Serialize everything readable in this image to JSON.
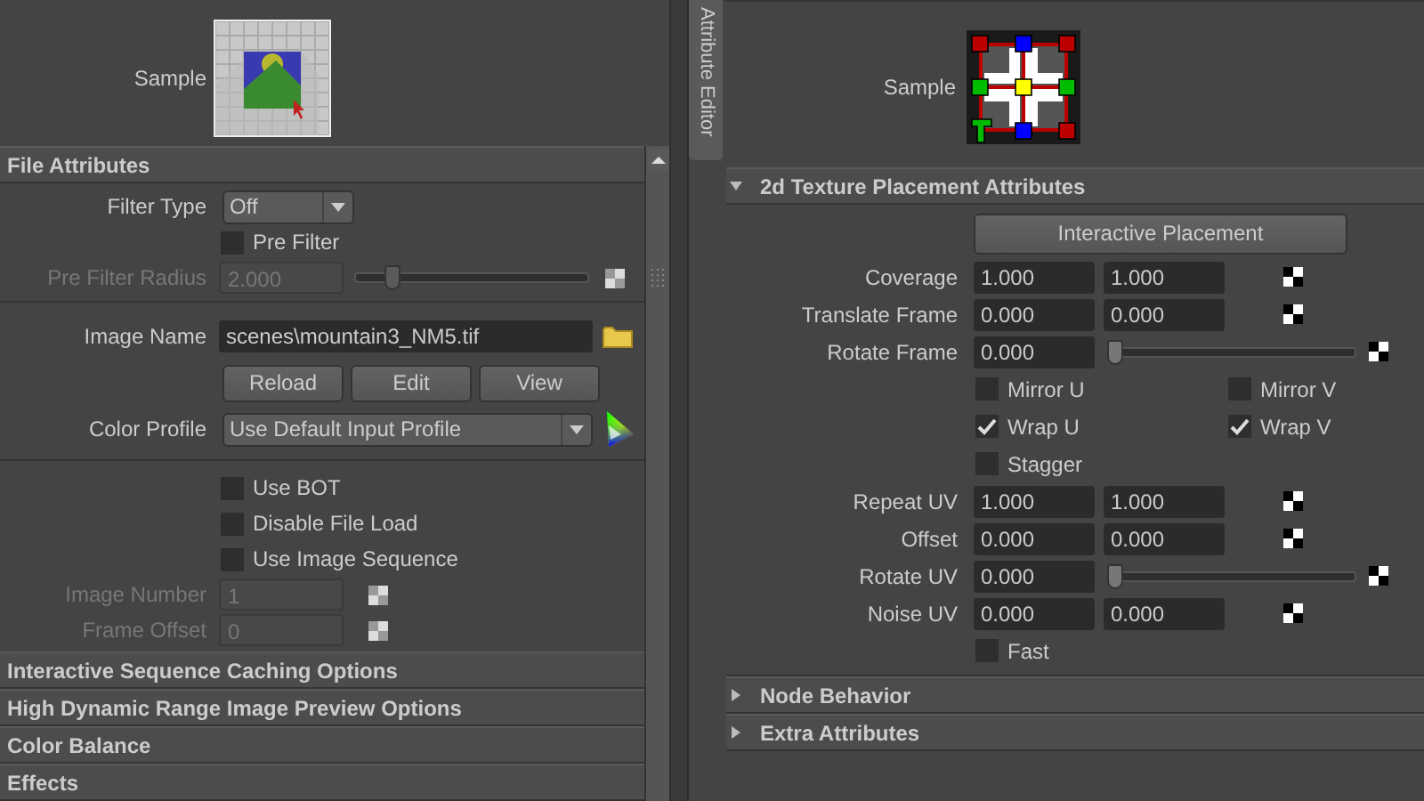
{
  "left_panel": {
    "sample_label": "Sample",
    "file_attributes": {
      "title": "File Attributes",
      "groups": [
        [
          {
            "kind": "dropdown",
            "label": "Filter Type",
            "value": "Off"
          },
          {
            "kind": "checkbox",
            "label": "Pre Filter",
            "checked": false
          },
          {
            "kind": "slider",
            "label": "Pre Filter Radius",
            "value": "2.000",
            "level": 0.13,
            "disabled": true
          }
        ],
        [
          {
            "kind": "file",
            "label": "Image Name",
            "value": "scenes\\mountain3_NM5.tif"
          },
          {
            "kind": "buttons",
            "buttons": [
              "Reload",
              "Edit",
              "View"
            ]
          },
          {
            "kind": "profile",
            "label": "Color Profile",
            "value": "Use Default Input Profile"
          }
        ],
        [
          {
            "kind": "checkbox",
            "label": "Use BOT",
            "checked": false
          },
          {
            "kind": "checkbox",
            "label": "Disable File Load",
            "checked": false
          },
          {
            "kind": "checkbox",
            "label": "Use Image Sequence",
            "checked": false
          },
          {
            "kind": "number",
            "label": "Image Number",
            "value": "1",
            "disabled": true
          },
          {
            "kind": "number",
            "label": "Frame Offset",
            "value": "0",
            "disabled": true
          }
        ]
      ]
    },
    "collapsed_sections": [
      "Interactive Sequence Caching Options",
      "High Dynamic Range Image Preview Options",
      "Color Balance",
      "Effects"
    ]
  },
  "side_tab": {
    "label": "Attribute Editor"
  },
  "right_panel": {
    "sample_label": "Sample",
    "sections": [
      {
        "title": "2d Texture Placement Attributes",
        "expanded": true,
        "rows": [
          {
            "kind": "button",
            "label": "Interactive Placement"
          },
          {
            "kind": "pair",
            "label": "Coverage",
            "values": [
              "1.000",
              "1.000"
            ]
          },
          {
            "kind": "pair",
            "label": "Translate Frame",
            "values": [
              "0.000",
              "0.000"
            ]
          },
          {
            "kind": "slider",
            "label": "Rotate Frame",
            "value": "0.000",
            "level": 0
          },
          {
            "kind": "checkpair",
            "items": [
              {
                "label": "Mirror U",
                "checked": false
              },
              {
                "label": "Mirror V",
                "checked": false
              }
            ]
          },
          {
            "kind": "checkpair",
            "items": [
              {
                "label": "Wrap U",
                "checked": true
              },
              {
                "label": "Wrap V",
                "checked": true
              }
            ]
          },
          {
            "kind": "checkbox",
            "label": "Stagger",
            "checked": false
          },
          {
            "kind": "pair",
            "label": "Repeat UV",
            "values": [
              "1.000",
              "1.000"
            ]
          },
          {
            "kind": "pair",
            "label": "Offset",
            "values": [
              "0.000",
              "0.000"
            ]
          },
          {
            "kind": "slider",
            "label": "Rotate UV",
            "value": "0.000",
            "level": 0
          },
          {
            "kind": "pair",
            "label": "Noise UV",
            "values": [
              "0.000",
              "0.000"
            ]
          },
          {
            "kind": "checkbox",
            "label": "Fast",
            "checked": false
          }
        ]
      },
      {
        "title": "Node Behavior",
        "expanded": false
      },
      {
        "title": "Extra Attributes",
        "expanded": false
      }
    ]
  }
}
